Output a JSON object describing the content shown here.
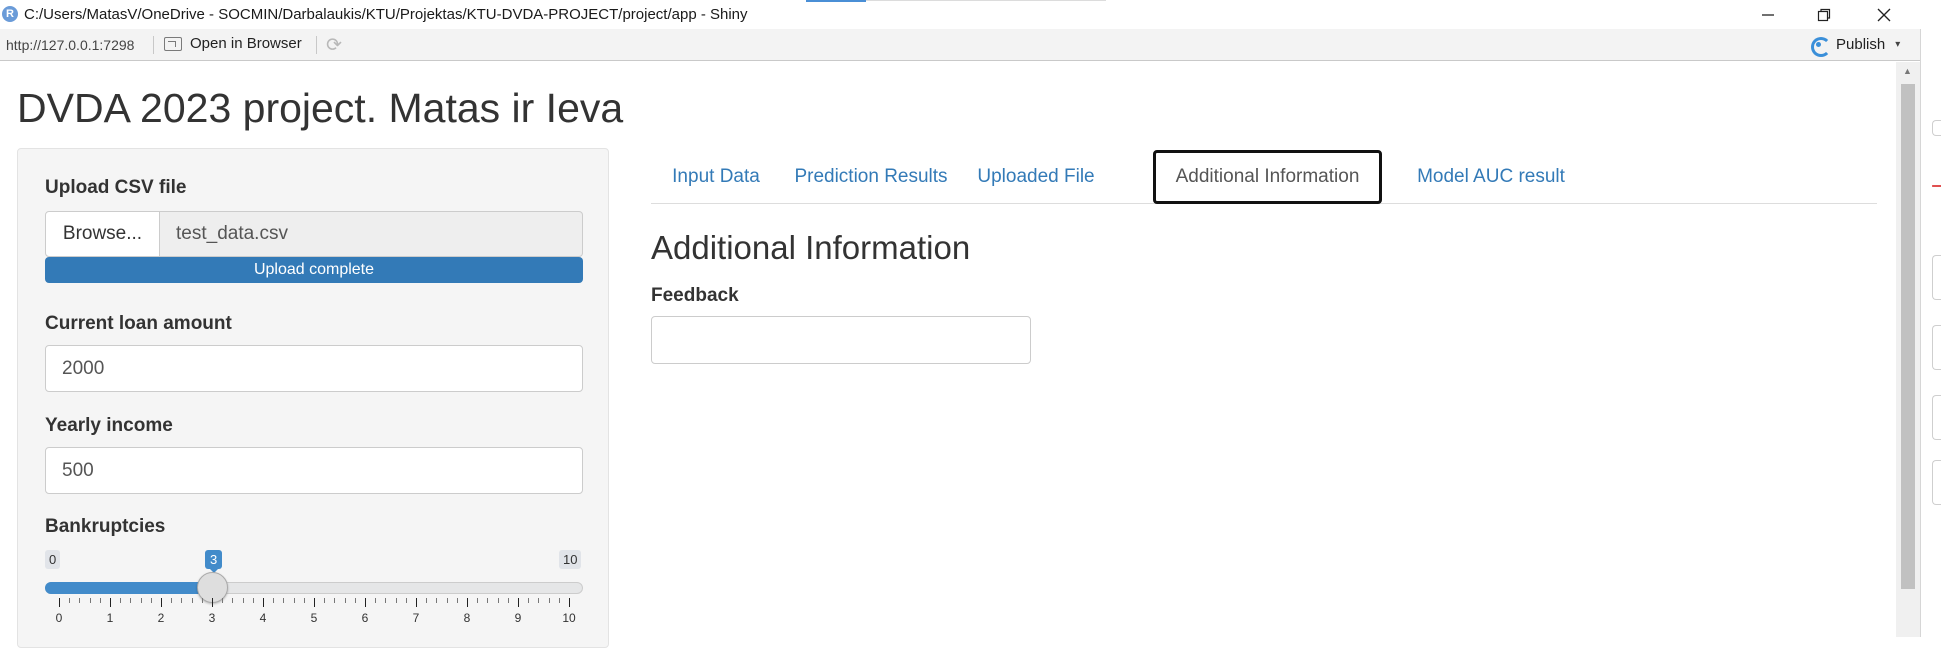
{
  "window": {
    "title": "C:/Users/MatasV/OneDrive - SOCMIN/Darbalaukis/KTU/Projektas/KTU-DVDA-PROJECT/project/app - Shiny",
    "app_icon": "R",
    "minimize_icon": "minimize-icon",
    "restore_icon": "restore-icon",
    "close_icon": "close-icon"
  },
  "toolbar": {
    "url": "http://127.0.0.1:7298",
    "open_in_browser": "Open in Browser",
    "publish": "Publish",
    "publish_caret": "▾"
  },
  "page": {
    "title": "DVDA 2023 project. Matas ir Ieva"
  },
  "sidebar": {
    "upload_label": "Upload CSV file",
    "browse_label": "Browse...",
    "file_name": "test_data.csv",
    "upload_status": "Upload complete",
    "upload_progress_percent": 100,
    "loan_label": "Current loan amount",
    "loan_value": "2000",
    "income_label": "Yearly income",
    "income_value": "500",
    "bankruptcies_label": "Bankruptcies",
    "slider": {
      "min": 0,
      "max": 10,
      "value": 3,
      "min_label": "0",
      "max_label": "10",
      "value_label": "3",
      "tick_labels": [
        "0",
        "1",
        "2",
        "3",
        "4",
        "5",
        "6",
        "7",
        "8",
        "9",
        "10"
      ]
    }
  },
  "tabs": [
    {
      "label": "Input Data",
      "active": false
    },
    {
      "label": "Prediction Results",
      "active": false
    },
    {
      "label": "Uploaded File",
      "active": false
    },
    {
      "label": "Additional Information",
      "active": true
    },
    {
      "label": "Model AUC result",
      "active": false
    }
  ],
  "main": {
    "section_title": "Additional Information",
    "feedback_label": "Feedback",
    "feedback_value": ""
  },
  "colors": {
    "primary": "#337ab7",
    "slider": "#428bca",
    "tab_link": "#337ab7",
    "sidebar_bg": "#f5f5f5"
  }
}
